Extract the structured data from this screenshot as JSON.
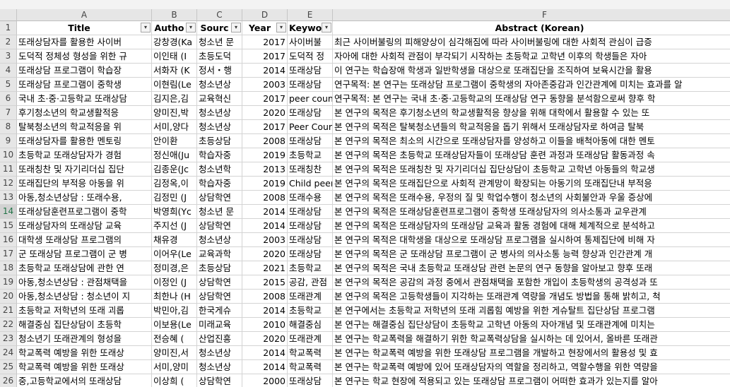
{
  "columns": [
    "A",
    "B",
    "C",
    "D",
    "E",
    "F"
  ],
  "header_row": {
    "number": "1",
    "cells": [
      "Title",
      "Autho",
      "Sourc",
      "Year",
      "Keywo",
      "Abstract (Korean)"
    ],
    "filter_glyphs": [
      "▾",
      "▾",
      "▾",
      "▾",
      "▾",
      "↓"
    ]
  },
  "rows": [
    {
      "n": "2",
      "cells": [
        "또래상담자를 활용한 사이버",
        "강창경(Ka",
        "청소년 문",
        "2017",
        "사이버불",
        "최근 사이버불링의 피해양상이 심각해짐에 따라 사이버불링에 대한 사회적 관심이 급증"
      ]
    },
    {
      "n": "3",
      "cells": [
        "도덕적 정체성 형성을 위한 규",
        "이인태 (I",
        "초등도덕",
        "2017",
        "도덕적 정",
        "자아에 대한 사회적 관점이 부각되기 시작하는 초등학교 고학년 이후의 학생들은 자아"
      ]
    },
    {
      "n": "4",
      "cells": [
        "또래상담 프로그램이 학습장",
        "서화자 (K",
        "정서・행",
        "2014",
        "또래상담",
        "이 연구는 학습장애 학생과 일반학생을 대상으로 또래집단을 조직하여 보육시간을 활용"
      ]
    },
    {
      "n": "5",
      "cells": [
        "또래상담 프로그램이 중학생",
        "이현림(Le",
        "청소년상",
        "2003",
        "또래상담",
        "연구목적: 본 연구는 또래상담 프로그램이 중학생의 자아존중감과 인간관계에 미치는 효과를 알"
      ]
    },
    {
      "n": "6",
      "cells": [
        "국내 초·중·고등학교 또래상담",
        "김지은,김",
        "교육혁신",
        "2017",
        "peer coun",
        "연구목적: 본 연구는 국내 초·중·고등학교의 또래상담 연구 동향을 분석함으로써 향후 학"
      ]
    },
    {
      "n": "7",
      "cells": [
        "후기청소년의 학교생활적응",
        "양미진,박",
        "청소년상",
        "2020",
        "또래상담",
        "본 연구의 목적은 후기청소년의 학교생활적응 향상을 위해 대학에서 활용할 수 있는 또"
      ]
    },
    {
      "n": "8",
      "cells": [
        "탈북청소년의 학교적응을 위",
        "서미,양다",
        "청소년상",
        "2017",
        "Peer Cour",
        "본 연구의 목적은 탈북청소년들의 학교적응을 돕기 위해서 또래상담자로 하여금 탈북"
      ]
    },
    {
      "n": "9",
      "cells": [
        "또래상담자를 활용한 멘토링",
        "안이환",
        "초등상담",
        "2008",
        "또래상담",
        "본 연구의 목적은 최소의 시간으로 또래상담자를 양성하고 이들을 배척아동에 대한 멘토"
      ]
    },
    {
      "n": "10",
      "cells": [
        "초등학교 또래상담자가 경험",
        "정신애(Ju",
        "학습자중",
        "2019",
        "초등학교",
        "본 연구의 목적은 초등학교 또래상담자들이 또래상담 훈련 과정과 또래상담 활동과정 속"
      ]
    },
    {
      "n": "11",
      "cells": [
        "또래칭찬 및 자기리더십 집단",
        "김종운(Jc",
        "청소년학",
        "2013",
        "또래칭찬",
        "본 연구의 목적은 또래칭찬 및 자기리더십 집단상담이 초등학교 고학년 아동들의 학교생"
      ]
    },
    {
      "n": "12",
      "cells": [
        "또래집단의 부적응 아동을 위",
        "김정옥,이",
        "학습자중",
        "2019",
        "Child peer",
        "본 연구의 목적은 또래집단으로 사회적 관계망이 확장되는 아동기의 또래집단내 부적응"
      ]
    },
    {
      "n": "13",
      "cells": [
        "아동,청소년상담 : 또래수용,",
        "김정민 (J",
        "상담학연",
        "2008",
        "또래수용",
        "본 연구의 목적은 또래수용, 우정의 질 및 학업수행이 청소년의 사회불안과 우울 증상에"
      ]
    },
    {
      "n": "14",
      "cells": [
        "또래상담훈련프로그램이 중학",
        "박영희(Yc",
        "청소년 문",
        "2014",
        "또래상담",
        "본 연구의 목적은 또래상담훈련프로그램이 중학생 또래상담자의 의사소통과 교우관계"
      ]
    },
    {
      "n": "15",
      "cells": [
        "또래상담자의 또래상담 교육",
        "주지선 (J",
        "상담학연",
        "2014",
        "또래상담",
        "본 연구의 목적은 또래상담자의 또래상담 교육과 활동 경험에 대해 체계적으로 분석하고"
      ]
    },
    {
      "n": "16",
      "cells": [
        "대학생 또래상담 프로그램의",
        "채유경",
        "청소년상",
        "2003",
        "또래상담",
        "본 연구의 목적은 대학생을 대상으로 또래상담 프로그램을 실시하여 통제집단에 비해 자"
      ]
    },
    {
      "n": "17",
      "cells": [
        "군 또래상담 프로그램이 군 병",
        "이어우(Le",
        "교육과학",
        "2020",
        "또래상담",
        "본 연구의 목적은 군 또래상담 프로그램이 군 병사의 의사소통 능력 향상과 인간관계 개"
      ]
    },
    {
      "n": "18",
      "cells": [
        "초등학교 또래상담에 관한 연",
        "정미경,은",
        "초등상담",
        "2021",
        "초등학교",
        "본 연구의 목적은 국내 초등학교 또래상담 관련 논문의 연구 동향을 알아보고 향후 또래"
      ]
    },
    {
      "n": "19",
      "cells": [
        "아동,청소년상담 : 관점채택을",
        "이정인 (J",
        "상담학연",
        "2015",
        "공감, 관점",
        "본 연구의 목적은 공감의 과정 중에서 관점채택을 포함한 개입이 초등학생의 공격성과 또"
      ]
    },
    {
      "n": "20",
      "cells": [
        "아동,청소년상담 : 청소년이 지",
        "최한나 (H",
        "상담학연",
        "2008",
        "또래관계",
        "본 연구의 목적은 고등학생들이 지각하는 또래관계 역량을 개념도 방법을 통해 밝히고, 척"
      ]
    },
    {
      "n": "21",
      "cells": [
        "초등학교 저학년의 또래 괴롭",
        "박민아,김",
        "한국게슈",
        "2014",
        "초등학교",
        "본 연구에서는 초등학교 저학년의 또래 괴롭힘 예방을 위한 게슈탈트 집단상담 프로그램"
      ]
    },
    {
      "n": "22",
      "cells": [
        "해결중심 집단상담이 초등학",
        "이보용(Le",
        "미래교육",
        "2010",
        "해결중심",
        "본 연구는 해결중심 집단상담이 초등학교 고학년 아동의 자아개념 및 또래관계에 미치는"
      ]
    },
    {
      "n": "23",
      "cells": [
        "청소년기 또래관계의 형성을",
        "전승혜 (",
        "산업진흥",
        "2020",
        "또래관계",
        "본 연구는 학교폭력을 해결하기 위한 학교폭력상담을 실시하는 데 있어서, 올바른 또래관"
      ]
    },
    {
      "n": "24",
      "cells": [
        "학교폭력 예방을 위한 또래상",
        "양미진,서",
        "청소년상",
        "2014",
        "학교폭력",
        "본 연구는 학교폭력 예방을 위한 또래상담 프로그램을 개발하고 현장에서의 활용성 및 효"
      ]
    },
    {
      "n": "25",
      "cells": [
        "학교폭력 예방을 위한 또래상",
        "서미,양미",
        "청소년상",
        "2014",
        "학교폭력",
        "본 연구는 학교폭력 예방에 있어 또래상담자의 역할을 정리하고, 역할수행을 위한 역량을"
      ]
    },
    {
      "n": "26",
      "cells": [
        "중,고등학교에서의 또래상담",
        "이상희 (",
        "상담학연",
        "2000",
        "또래상담",
        "본 연구는 학교 현장에 적용되고 있는 또래상담 프로그램이 어떠한 효과가 있는지를 알아"
      ]
    }
  ],
  "selected_row": "14",
  "colors": {
    "header_bg": "#e6e6e6",
    "grid": "#d4d4d4",
    "selected_row_header": "#217346"
  }
}
